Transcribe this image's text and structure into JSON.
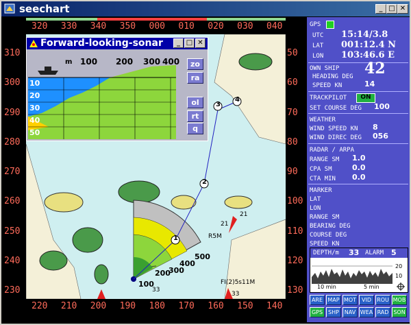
{
  "window": {
    "title": "seechart"
  },
  "compass_top": [
    "320",
    "330",
    "340",
    "350",
    "000",
    "010",
    "020",
    "030",
    "040"
  ],
  "compass_bottom": [
    "220",
    "210",
    "200",
    "190",
    "180",
    "170",
    "160",
    "150",
    "140"
  ],
  "compass_left": [
    "310",
    "300",
    "290",
    "280",
    "270",
    "260",
    "250",
    "240",
    "230"
  ],
  "compass_right": [
    "50",
    "60",
    "70",
    "80",
    "90",
    "100",
    "110",
    "120",
    "130"
  ],
  "sonar": {
    "title": "Forward-looking-sonar",
    "unit": "m",
    "range_labels": [
      "100",
      "200",
      "300",
      "400"
    ],
    "depth_labels": [
      "10",
      "20",
      "30",
      "40",
      "50"
    ],
    "buttons": [
      "zo",
      "ra",
      "ol",
      "rt",
      "q"
    ]
  },
  "chart": {
    "range_rings": [
      "100",
      "200",
      "300",
      "400",
      "500"
    ],
    "waypoints": [
      "1",
      "2",
      "3",
      "4"
    ],
    "annotations": [
      "R5M",
      "FI(2)5s11M",
      "21",
      "21",
      "33",
      "33"
    ]
  },
  "panel": {
    "gps_label": "GPS",
    "utc_label": "UTC",
    "utc_value": "15:14/3.8",
    "lat_label": "LAT",
    "lat_value": "001:12.4 N",
    "lon_label": "LON",
    "lon_value": "103:46.6 E",
    "own_ship_label": "OWN SHIP",
    "heading_label": "HEADING DEG",
    "heading_value": "42",
    "speed_label": "SPEED   KN",
    "speed_value": "14",
    "trackpilot_label": "TRACKPILOT",
    "trackpilot_state": "ON",
    "set_course_label": "SET COURSE DEG",
    "set_course_value": "100",
    "weather_label": "WEATHER",
    "wind_speed_label": "WIND SPEED  KN",
    "wind_speed_value": "8",
    "wind_dir_label": "WIND DIREC DEG",
    "wind_dir_value": "056",
    "radar_label": "RADAR / ARPA",
    "range_label": "RANGE SM",
    "range_value": "1.0",
    "cpa_label": "CPA SM",
    "cpa_value": "0.0",
    "cta_label": "CTA MIN",
    "cta_value": "0.0",
    "marker_label": "MARKER",
    "m_lat": "LAT",
    "m_lon": "LON",
    "m_range": "RANGE    SM",
    "m_bearing": "BEARING DEG",
    "m_course": "COURSE   DEG",
    "m_speed": "SPEED    KN",
    "depth_label": "DEPTH/m",
    "depth_value": "33",
    "alarm_label": "ALARM",
    "alarm_value": "5",
    "depth_axis": [
      "20",
      "10"
    ],
    "time_axis": [
      "10 min",
      "5 min"
    ],
    "buttons_row1": [
      "ARE",
      "MAP",
      "MOT",
      "VID",
      "ROU",
      "MOB"
    ],
    "buttons_row2": [
      "GPS",
      "SHP",
      "NAV",
      "WEA",
      "RAD",
      "SON"
    ]
  },
  "colors": {
    "accent": "#5050c8",
    "compass": "#ff6b5a",
    "sonar_blue": "#1e90ff",
    "sonar_green": "#8dd63c",
    "active_green": "#20b040"
  }
}
